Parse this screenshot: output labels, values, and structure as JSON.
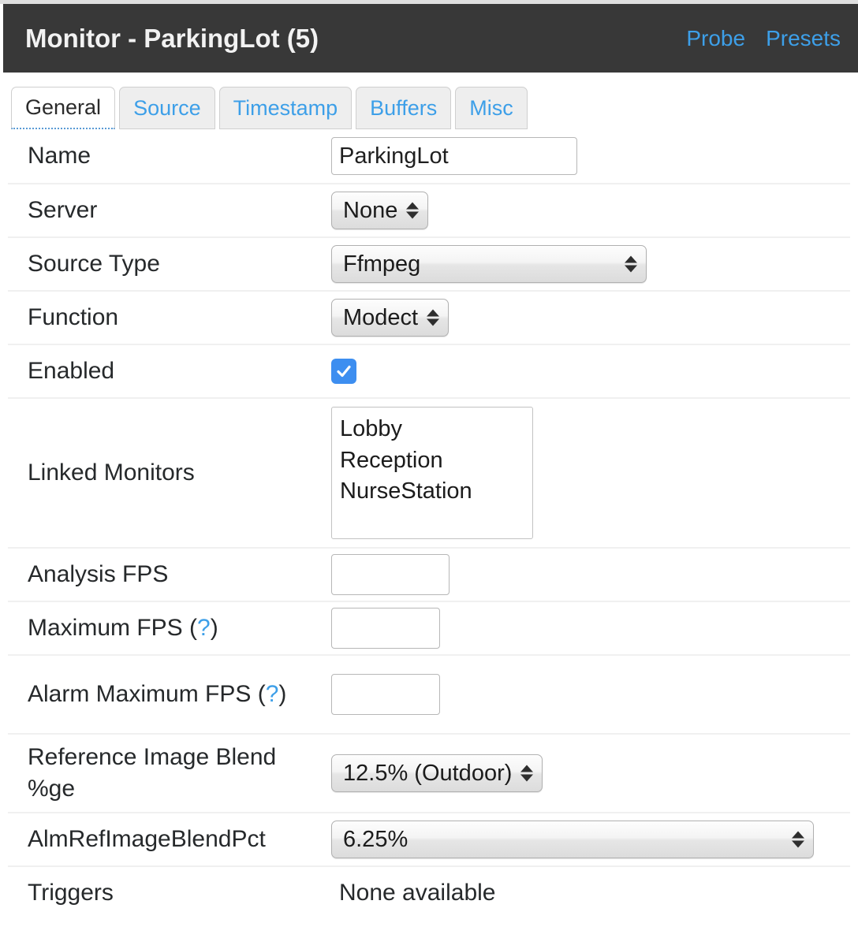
{
  "header": {
    "title": "Monitor - ParkingLot (5)",
    "links": [
      {
        "label": "Probe",
        "name": "probe-link"
      },
      {
        "label": "Presets",
        "name": "presets-link"
      }
    ]
  },
  "tabs": [
    {
      "label": "General",
      "active": true
    },
    {
      "label": "Source",
      "active": false
    },
    {
      "label": "Timestamp",
      "active": false
    },
    {
      "label": "Buffers",
      "active": false
    },
    {
      "label": "Misc",
      "active": false
    }
  ],
  "form": {
    "name": {
      "label": "Name",
      "value": "ParkingLot",
      "placeholder": ""
    },
    "server": {
      "label": "Server",
      "value": "None"
    },
    "source_type": {
      "label": "Source Type",
      "value": "Ffmpeg"
    },
    "function": {
      "label": "Function",
      "value": "Modect"
    },
    "enabled": {
      "label": "Enabled",
      "checked": true
    },
    "linked_monitors": {
      "label": "Linked Monitors",
      "options": [
        "Lobby",
        "Reception",
        "NurseStation"
      ]
    },
    "analysis_fps": {
      "label": "Analysis FPS",
      "value": "",
      "placeholder": ""
    },
    "maximum_fps": {
      "label": "Maximum FPS (",
      "help": "?",
      "label_tail": ")",
      "value": "",
      "placeholder": ""
    },
    "alarm_maximum_fps": {
      "label": "Alarm Maximum FPS (",
      "help": "?",
      "label_tail": ")",
      "value": "",
      "placeholder": ""
    },
    "reference_image_blend": {
      "label": "Reference Image Blend %ge",
      "value": "12.5% (Outdoor)"
    },
    "alm_ref_image_blend_pct": {
      "label": "AlmRefImageBlendPct",
      "value": "6.25%"
    },
    "triggers": {
      "label": "Triggers",
      "value": "None available"
    }
  },
  "colors": {
    "header_bg": "#383838",
    "link_blue": "#3d9fe8",
    "checkbox_blue": "#3d8ef0",
    "row_divider": "#f0f0f0",
    "text_dark": "#26292b"
  }
}
